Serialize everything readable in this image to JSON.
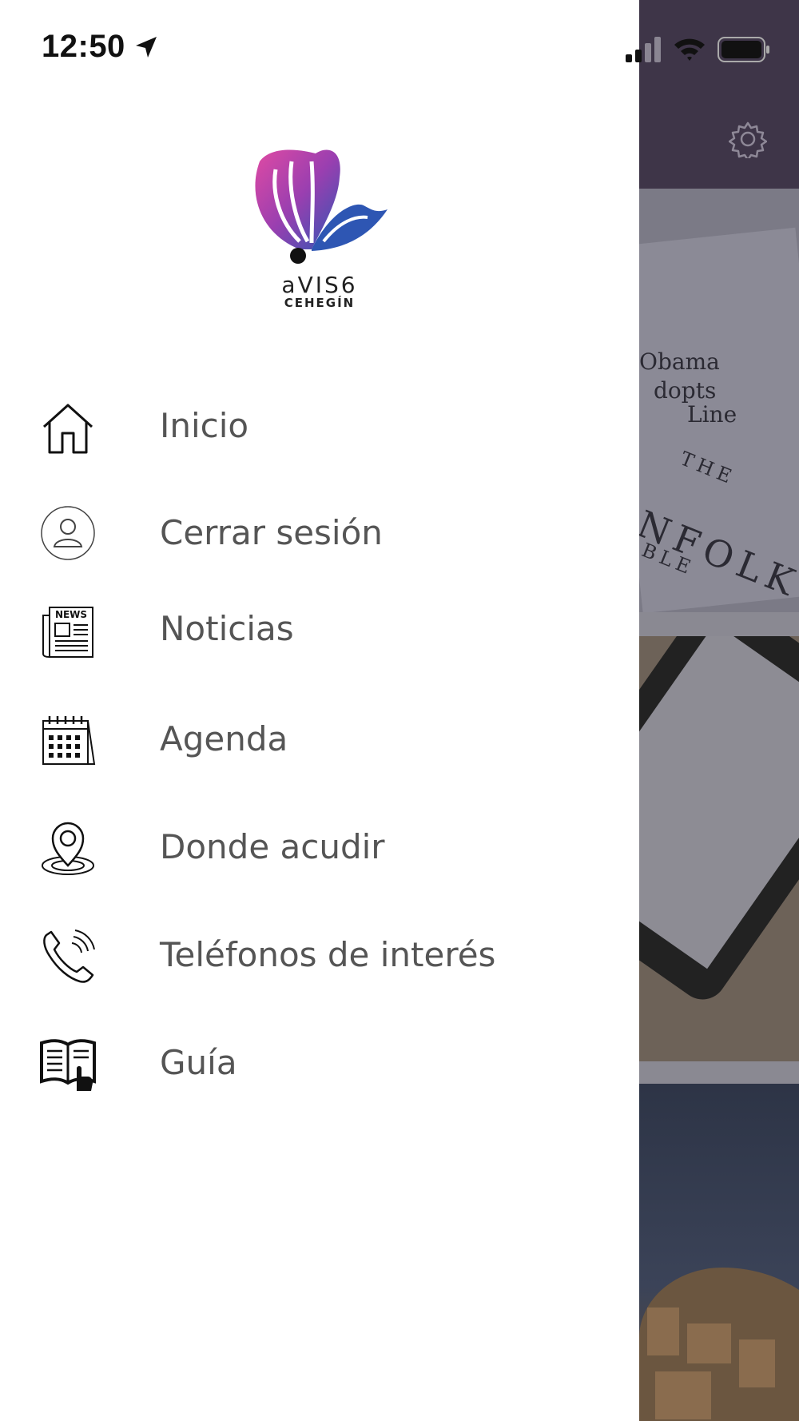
{
  "status_bar": {
    "time": "12:50"
  },
  "logo": {
    "line1": "aVIS6",
    "line2": "CEHEGÍN"
  },
  "menu": {
    "items": [
      {
        "label": "Inicio",
        "icon": "home-icon"
      },
      {
        "label": "Cerrar sesión",
        "icon": "user-icon"
      },
      {
        "label": "Noticias",
        "icon": "newspaper-icon"
      },
      {
        "label": "Agenda",
        "icon": "calendar-icon"
      },
      {
        "label": "Donde acudir",
        "icon": "location-pin-icon"
      },
      {
        "label": "Teléfonos de interés",
        "icon": "phone-icon"
      },
      {
        "label": "Guía",
        "icon": "guide-book-icon"
      }
    ]
  },
  "background": {
    "card1_text": [
      "Obama",
      "dopts",
      "Line",
      "THE",
      "NFOLK",
      "BLE"
    ]
  },
  "colors": {
    "header_bg": "#3e3548",
    "menu_text": "#555555",
    "logo_pink": "#d13d9b",
    "logo_blue": "#2e56b3"
  }
}
